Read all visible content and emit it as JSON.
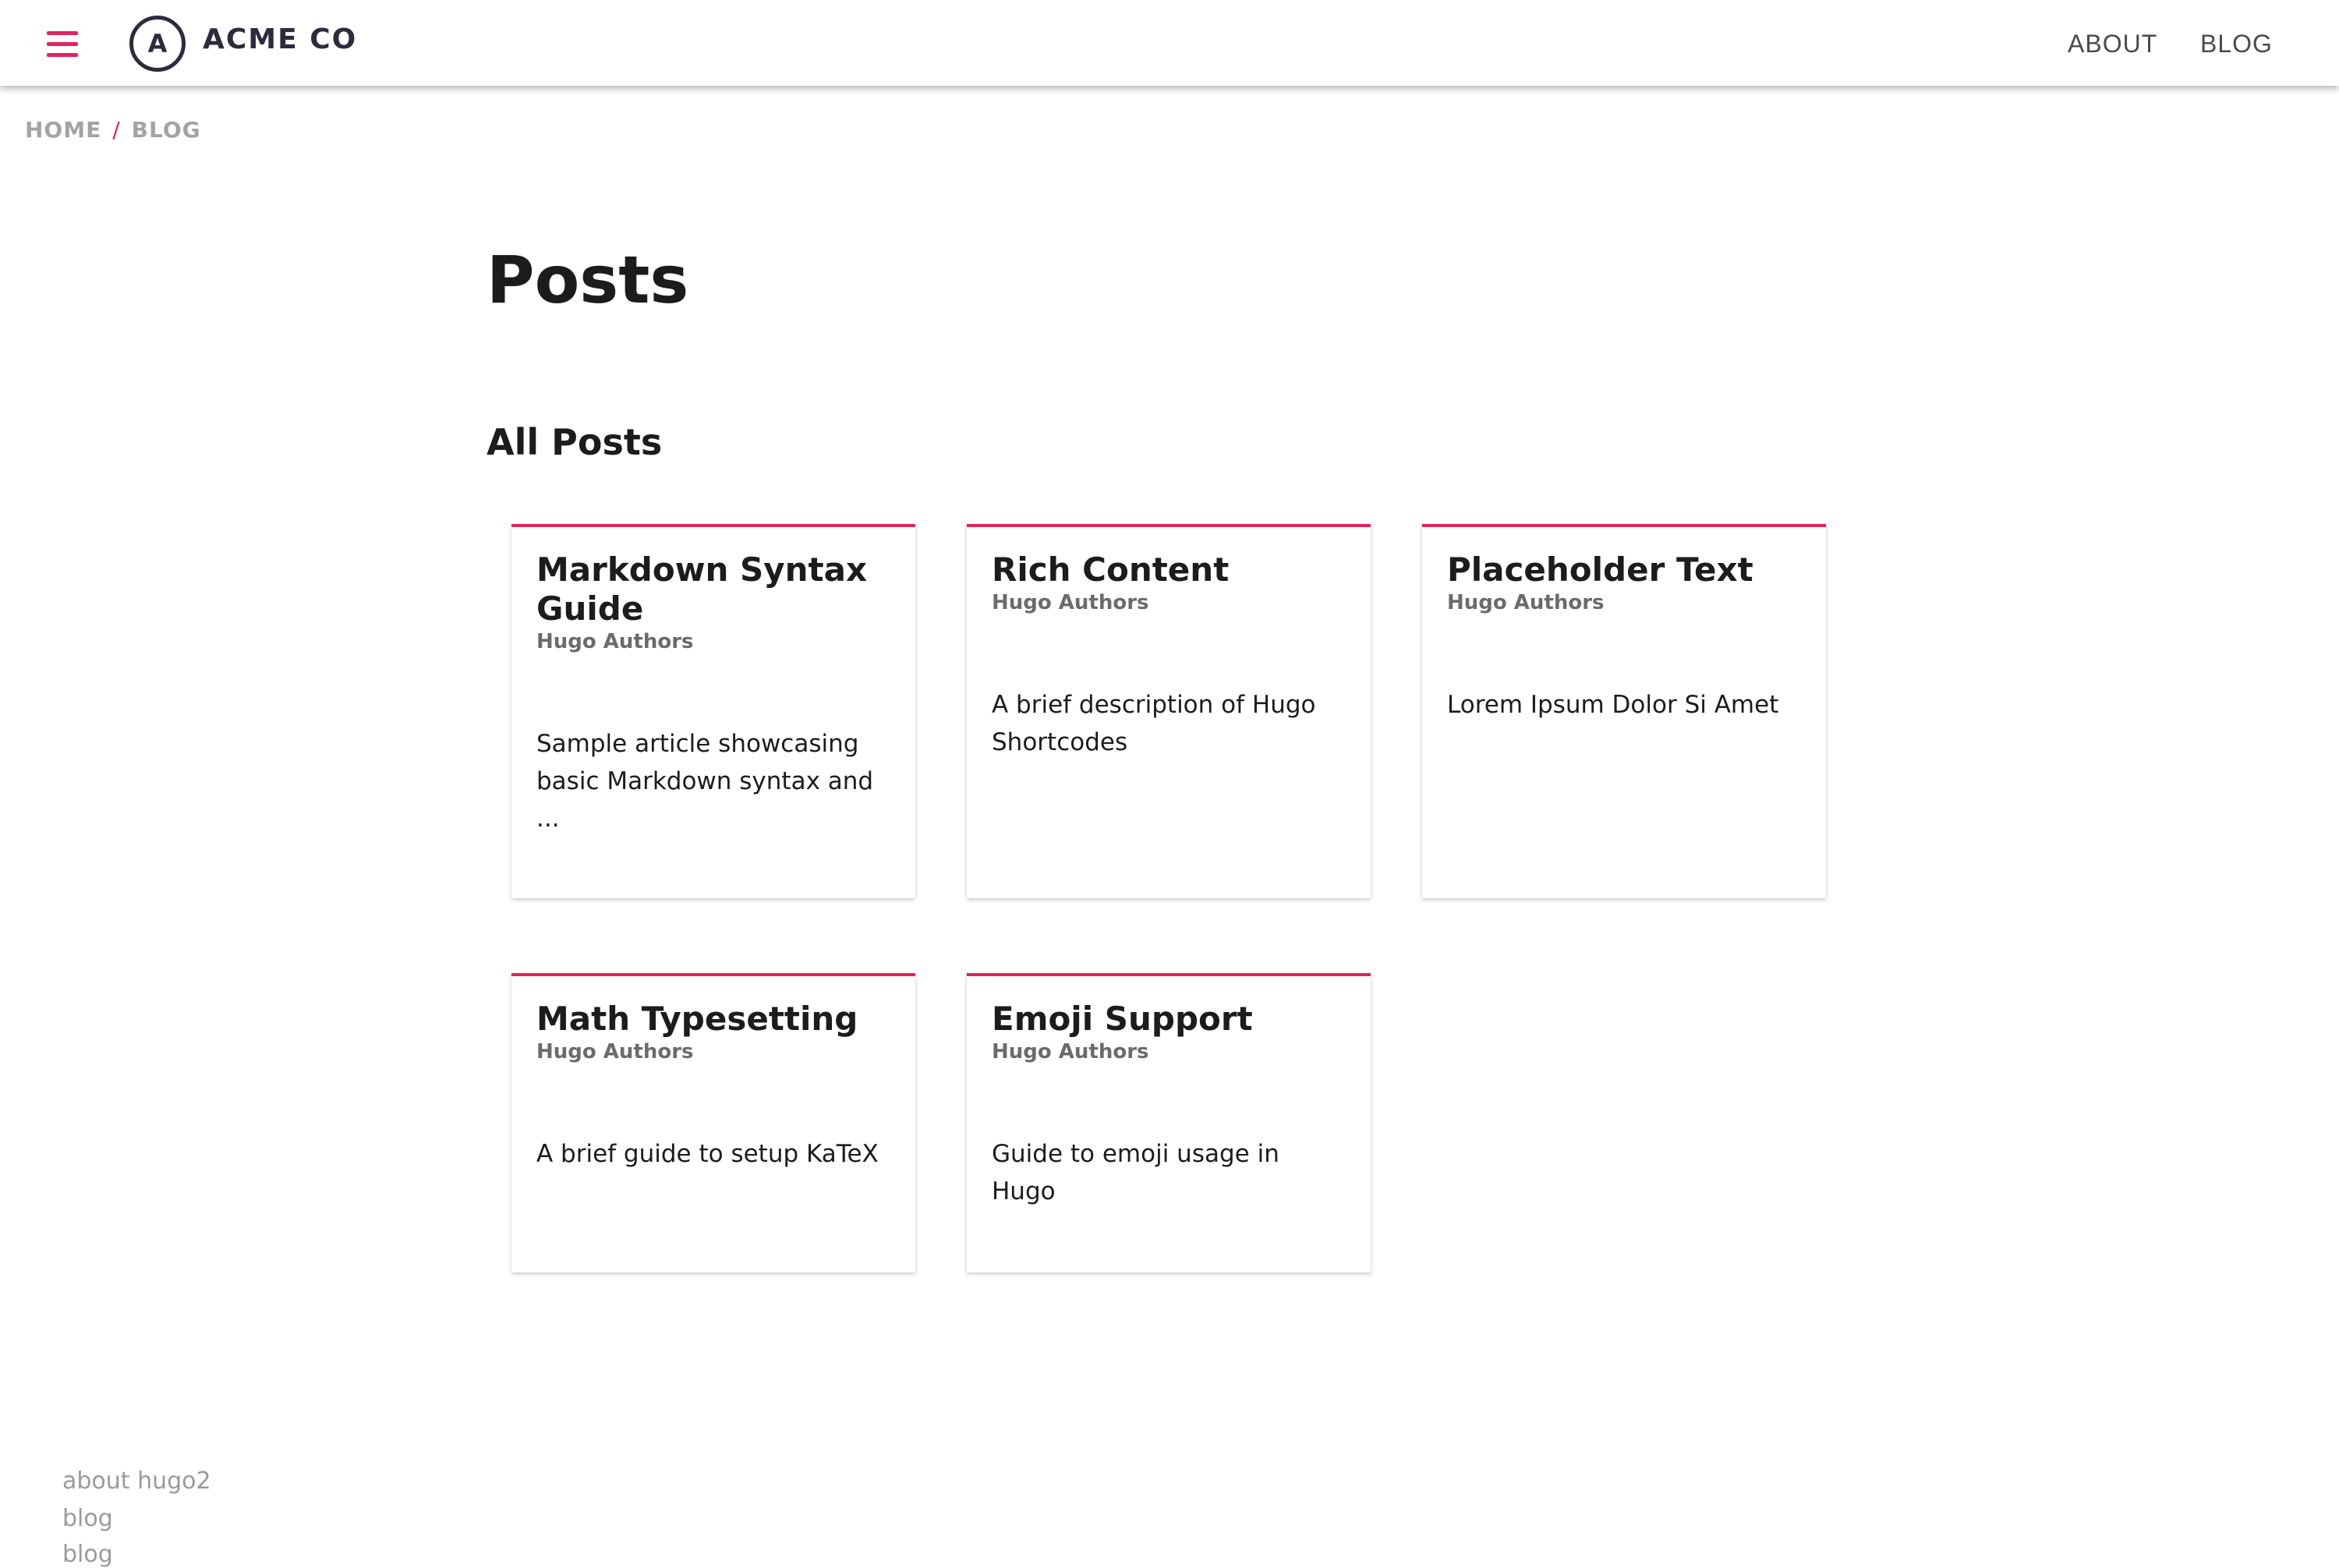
{
  "colors": {
    "accent": "#e0245e",
    "logo": "#2d2b3d",
    "muted": "#a3a3a3"
  },
  "header": {
    "menu_icon": "hamburger-menu-icon",
    "logo_letter": "A",
    "brand": "ACME CO",
    "nav": [
      {
        "label": "ABOUT"
      },
      {
        "label": "BLOG"
      }
    ]
  },
  "breadcrumb": {
    "home": "HOME",
    "separator": "/",
    "current": "BLOG"
  },
  "main": {
    "title": "Posts",
    "section_title": "All Posts",
    "cards": [
      {
        "title": "Markdown Syntax Guide",
        "author": "Hugo Authors",
        "desc": "Sample article showcasing basic Markdown syntax and ..."
      },
      {
        "title": "Rich Content",
        "author": "Hugo Authors",
        "desc": "A brief description of Hugo Shortcodes"
      },
      {
        "title": "Placeholder Text",
        "author": "Hugo Authors",
        "desc": "Lorem Ipsum Dolor Si Amet"
      },
      {
        "title": "Math Typesetting",
        "author": "Hugo Authors",
        "desc": "A brief guide to setup KaTeX"
      },
      {
        "title": "Emoji Support",
        "author": "Hugo Authors",
        "desc": "Guide to emoji usage in Hugo"
      }
    ]
  },
  "footer": {
    "links": [
      {
        "label": "about hugo2"
      },
      {
        "label": "blog"
      },
      {
        "label": "blog"
      }
    ]
  }
}
